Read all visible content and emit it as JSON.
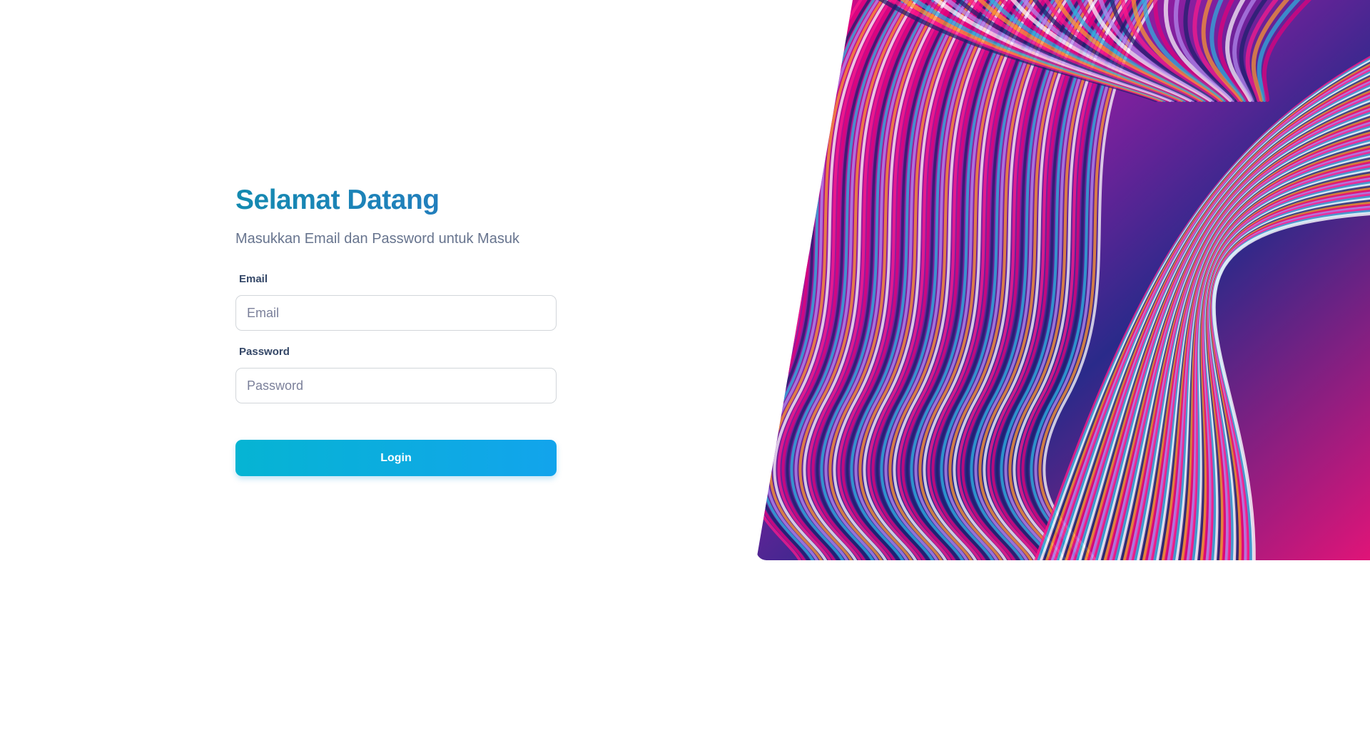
{
  "login": {
    "title": "Selamat Datang",
    "subtitle": "Masukkan Email dan Password untuk Masuk",
    "email_label": "Email",
    "email_placeholder": "Email",
    "email_value": "",
    "password_label": "Password",
    "password_placeholder": "Password",
    "password_value": "",
    "login_button_label": "Login"
  },
  "colors": {
    "title_gradient_start": "#148ab0",
    "title_gradient_end": "#2a78c4",
    "button_gradient_start": "#06b4d3",
    "button_gradient_end": "#12a4ec",
    "text_muted": "#67748e",
    "label_text": "#344767"
  },
  "hero": {
    "image_description_icon": "abstract-swirl-artwork",
    "palette": [
      "#ff1a8c",
      "#e6007a",
      "#1a1f6b",
      "#2bb5e0",
      "#b48cf0",
      "#ff9a2e",
      "#ffffff"
    ]
  }
}
